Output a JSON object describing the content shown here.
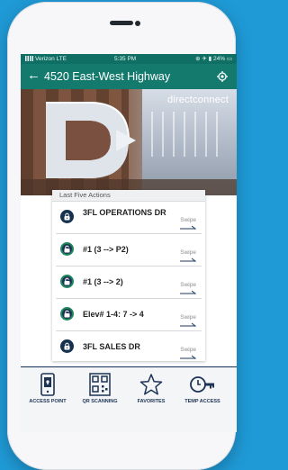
{
  "status_bar": {
    "carrier": "Verizon  LTE",
    "time": "5:35 PM",
    "battery": "24%"
  },
  "header": {
    "back_symbol": "←",
    "title": "4520 East-West Highway"
  },
  "hero": {
    "brand": "directconnect"
  },
  "actions": {
    "heading": "Last Five Actions",
    "swipe_label": "Swipe",
    "items": [
      {
        "label": "3FL OPERATIONS DR",
        "icon": "lock-icon"
      },
      {
        "label": "#1 (3 --> P2)",
        "icon": "unlocked-lock-icon"
      },
      {
        "label": "#1 (3 --> 2)",
        "icon": "unlocked-lock-icon"
      },
      {
        "label": "Elev# 1-4: 7 -> 4",
        "icon": "unlocked-lock-icon"
      },
      {
        "label": "3FL SALES DR",
        "icon": "lock-icon"
      }
    ]
  },
  "bottom_nav": [
    {
      "label": "ACCESS POINT",
      "icon": "access-point-icon"
    },
    {
      "label": "QR SCANNING",
      "icon": "qr-code-icon"
    },
    {
      "label": "FAVORITES",
      "icon": "star-icon"
    },
    {
      "label": "TEMP ACCESS",
      "icon": "clock-key-icon"
    }
  ],
  "colors": {
    "background": "#1f9ad6",
    "app_bar": "#157a6e",
    "navy": "#16304f",
    "accent_green": "#1e8a5c"
  }
}
